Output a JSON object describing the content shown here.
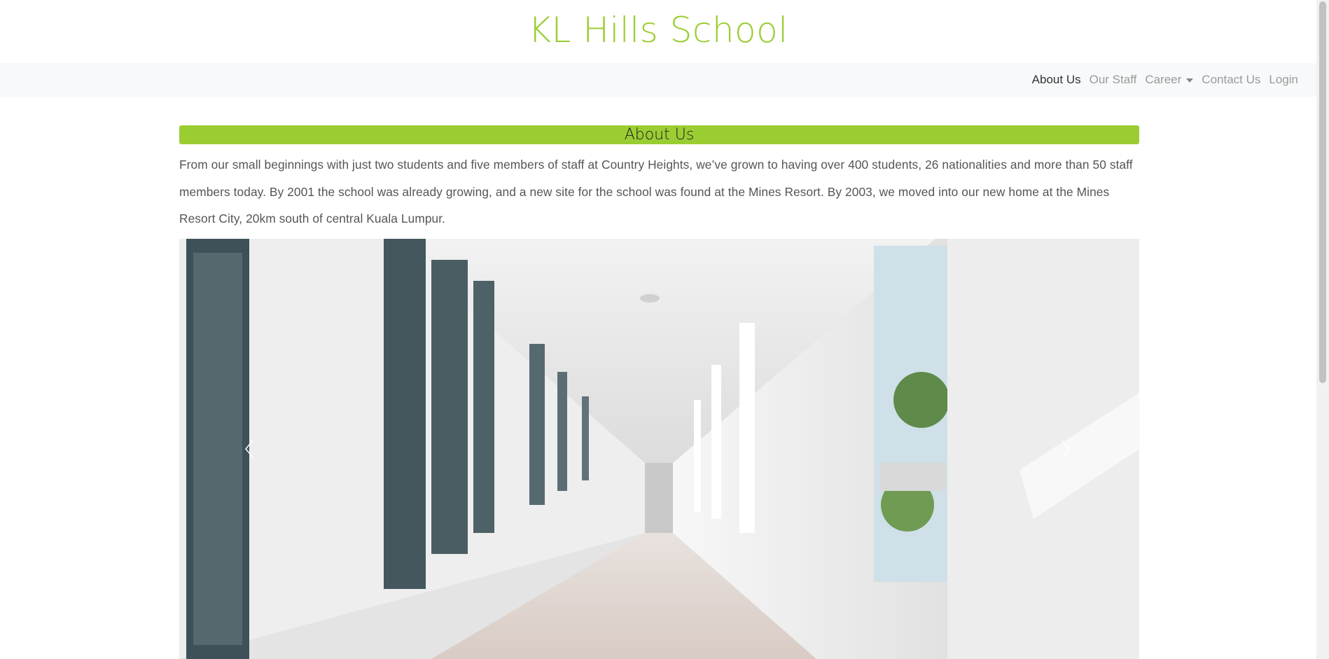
{
  "site": {
    "title": "KL Hills School"
  },
  "nav": {
    "items": [
      {
        "label": "About Us"
      },
      {
        "label": "Our Staff"
      },
      {
        "label": "Career"
      },
      {
        "label": "Contact Us"
      },
      {
        "label": "Login"
      }
    ]
  },
  "about": {
    "heading": "About Us",
    "paragraph": "From our small beginnings with just two students and five members of staff at Country Heights, we’ve grown to having over 400 students, 26 nationalities and more than 50 staff members today. By 2001 the school was already growing, and a new site for the school was found at the Mines Resort. By 2003, we moved into our new home at the Mines Resort City, 20km south of central Kuala Lumpur."
  },
  "carousel": {
    "prev_icon": "chevron-left-icon",
    "next_icon": "chevron-right-icon"
  },
  "colors": {
    "accent": "#9acd32",
    "navbar_bg": "#f8f9fa",
    "active_nav": "#333333",
    "inactive_nav": "#9a9a9a"
  }
}
